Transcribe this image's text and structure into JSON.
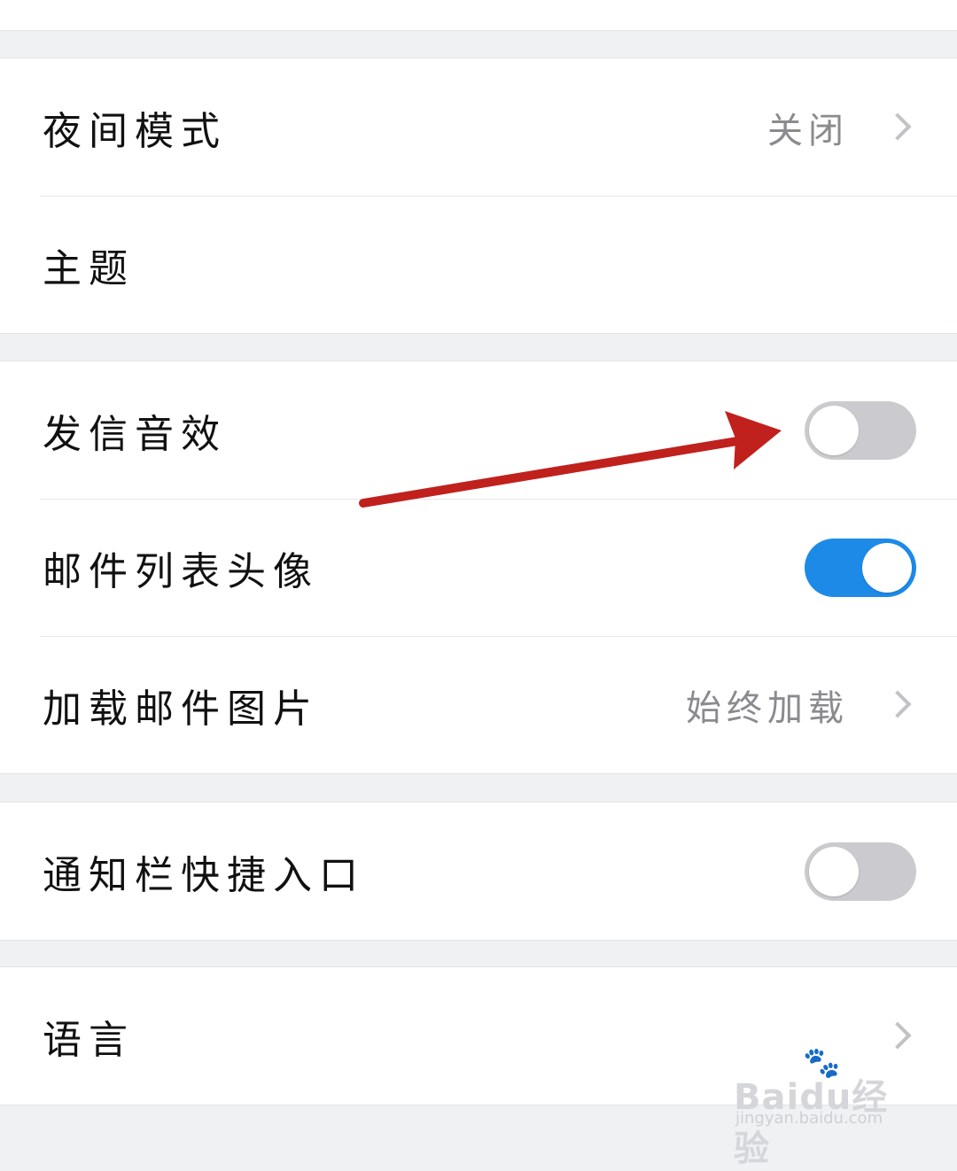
{
  "groups": [
    {
      "rows": [
        {
          "label": "夜间模式",
          "value": "关闭",
          "control": "chevron"
        },
        {
          "label": "主题",
          "control": "none"
        }
      ]
    },
    {
      "rows": [
        {
          "label": "发信音效",
          "control": "toggle",
          "on": false
        },
        {
          "label": "邮件列表头像",
          "control": "toggle",
          "on": true
        },
        {
          "label": "加载邮件图片",
          "value": "始终加载",
          "control": "chevron"
        }
      ]
    },
    {
      "rows": [
        {
          "label": "通知栏快捷入口",
          "control": "toggle",
          "on": false
        }
      ]
    },
    {
      "rows": [
        {
          "label": "语言",
          "control": "chevron"
        }
      ]
    }
  ],
  "colors": {
    "toggle_on": "#1d8ae8",
    "toggle_off": "#cbcbcf",
    "annotation_arrow": "#c0211d"
  },
  "annotation": {
    "type": "arrow",
    "points_to": "发信音效 toggle"
  },
  "watermark": {
    "brand": "Baidu经验",
    "url": "jingyan.baidu.com"
  }
}
